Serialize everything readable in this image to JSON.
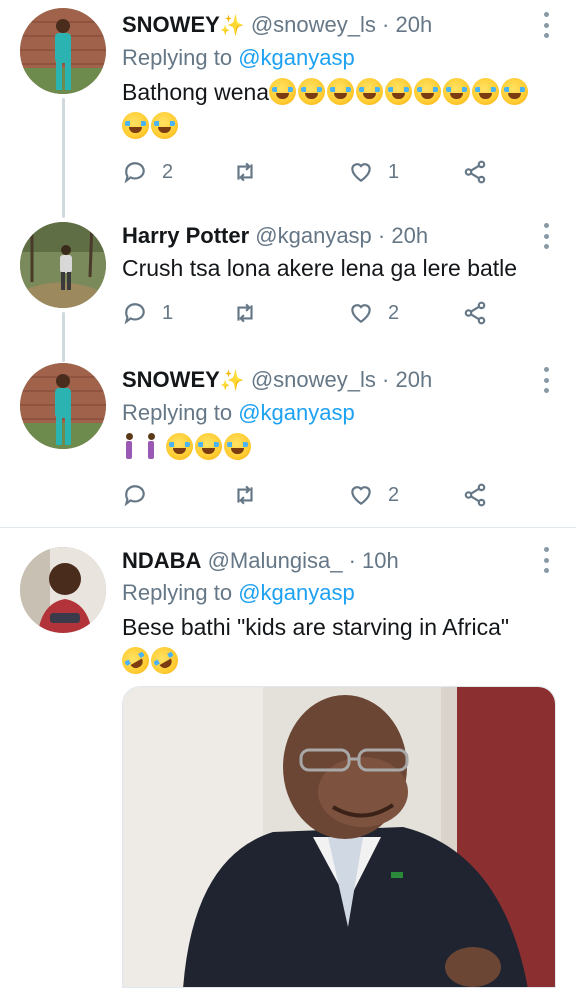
{
  "tweets": [
    {
      "name": "SNOWEY",
      "sparkle": "✨",
      "handle": "@snowey_ls",
      "dot": "·",
      "time": "20h",
      "replying_prefix": "Replying to",
      "replying_to": "@kganyasp",
      "text": "Bathong wena",
      "emoji": "face-with-tears-of-joy x11",
      "reply_count": "2",
      "retweet_count": "",
      "like_count": "1"
    },
    {
      "name": "Harry Potter",
      "handle": "@kganyasp",
      "dot": "·",
      "time": "20h",
      "text": "Crush tsa lona akere lena ga lere batle",
      "reply_count": "1",
      "retweet_count": "",
      "like_count": "2"
    },
    {
      "name": "SNOWEY",
      "sparkle": "✨",
      "handle": "@snowey_ls",
      "dot": "·",
      "time": "20h",
      "replying_prefix": "Replying to",
      "replying_to": "@kganyasp",
      "emoji": "woman-walking x2, face-with-tears-of-joy x3",
      "reply_count": "",
      "retweet_count": "",
      "like_count": "2"
    },
    {
      "name": "NDABA",
      "handle": "@Malungisa_",
      "dot": "·",
      "time": "10h",
      "replying_prefix": "Replying to",
      "replying_to": "@kganyasp",
      "text": "Bese bathi \"kids are starving in Africa\"",
      "emoji": "rolling-on-the-floor-laughing x2"
    }
  ],
  "icons": {
    "reply": "reply-icon",
    "retweet": "retweet-icon",
    "like": "heart-icon",
    "share": "share-icon",
    "more": "more-vertical-icon"
  },
  "colors": {
    "accent": "#1da1f2",
    "secondary_text": "#657786",
    "divider": "#e1e8ed"
  }
}
